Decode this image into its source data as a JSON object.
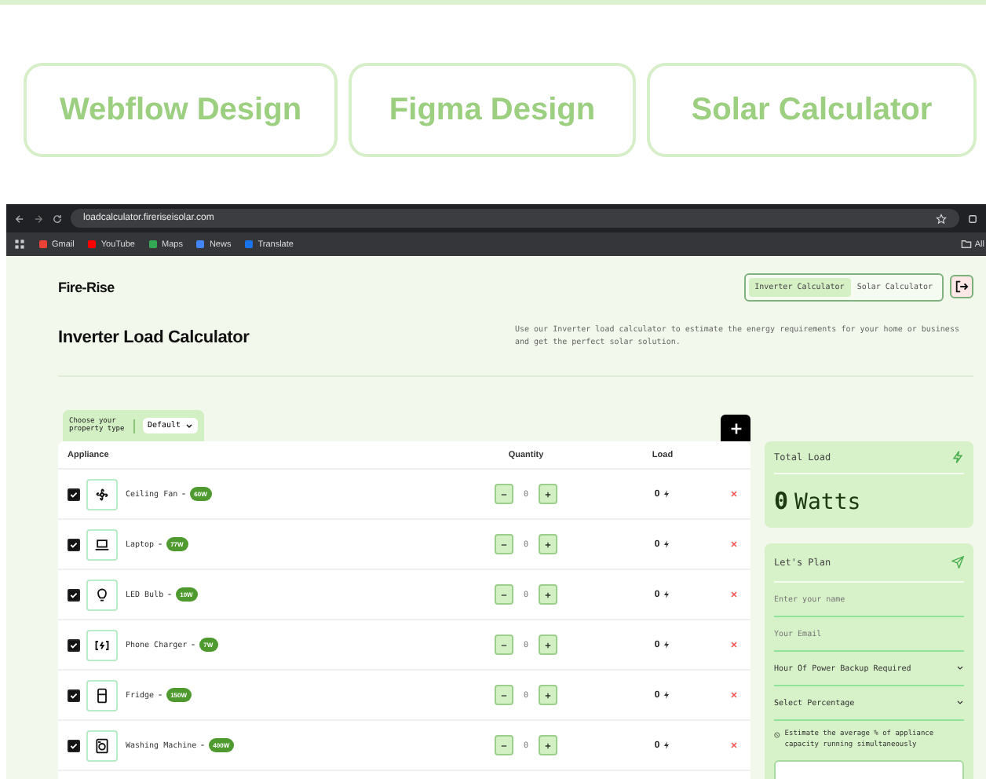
{
  "top_buttons": [
    "Webflow Design",
    "Figma Design",
    "Solar Calculator"
  ],
  "browser": {
    "url": "loadcalculator.fireriseisolar.com",
    "bookmarks": [
      {
        "label": "Gmail",
        "color": "#ea4335"
      },
      {
        "label": "YouTube",
        "color": "#ff0000"
      },
      {
        "label": "Maps",
        "color": "#34a853"
      },
      {
        "label": "News",
        "color": "#4285f4"
      },
      {
        "label": "Translate",
        "color": "#1a73e8"
      }
    ],
    "all_label": "All"
  },
  "site": {
    "logo": "Fire-Rise",
    "nav": [
      {
        "label": "Inverter Calculator",
        "selected": true
      },
      {
        "label": "Solar Calculator",
        "selected": false
      }
    ],
    "title": "Inverter Load Calculator",
    "description": "Use our Inverter load calculator to estimate the energy requirements for your home or business and get the perfect solar solution.",
    "property": {
      "label": "Choose your property type",
      "value": "Default"
    },
    "columns": [
      "Appliance",
      "Quantity",
      "Load"
    ],
    "rows": [
      {
        "kind": "fan",
        "name": "Ceiling Fan",
        "watts": "60W",
        "checked": true,
        "quantity": "0",
        "load": "0"
      },
      {
        "kind": "laptop",
        "name": "Laptop",
        "watts": "77W",
        "checked": true,
        "quantity": "0",
        "load": "0"
      },
      {
        "kind": "bulb",
        "name": "LED Bulb",
        "watts": "10W",
        "checked": true,
        "quantity": "0",
        "load": "0"
      },
      {
        "kind": "charger",
        "name": "Phone Charger",
        "watts": "7W",
        "checked": true,
        "quantity": "0",
        "load": "0"
      },
      {
        "kind": "fridge",
        "name": "Fridge",
        "watts": "150W",
        "checked": true,
        "quantity": "0",
        "load": "0"
      },
      {
        "kind": "washer",
        "name": "Washing Machine",
        "watts": "400W",
        "checked": true,
        "quantity": "0",
        "load": "0"
      }
    ],
    "total": {
      "title": "Total Load",
      "value": "0",
      "unit": "Watts"
    },
    "plan": {
      "title": "Let's Plan",
      "fields": [
        {
          "kind": "input",
          "placeholder": "Enter your name"
        },
        {
          "kind": "input",
          "placeholder": "Your Email"
        },
        {
          "kind": "select",
          "value": "Hour Of Power Backup Required"
        },
        {
          "kind": "select",
          "value": "Select Percentage"
        }
      ],
      "hint": "Estimate the average % of appliance capacity running simultaneously"
    }
  }
}
